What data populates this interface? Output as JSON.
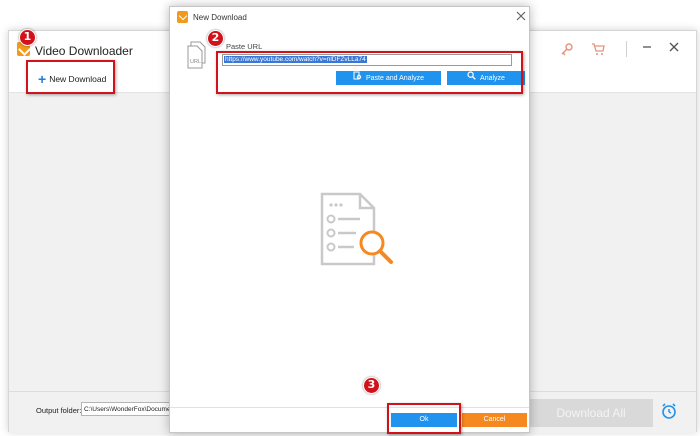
{
  "main_window": {
    "title": "Video Downloader",
    "toolbar": {
      "new_download_label": "New Download"
    },
    "bottom": {
      "output_folder_label": "Output folder:",
      "output_folder_value": "C:\\Users\\WonderFox\\Documents",
      "download_all_label": "Download All"
    },
    "icons": [
      "key-icon",
      "cart-icon",
      "minimize-icon",
      "close-icon",
      "alarm-clock-icon"
    ]
  },
  "dialog": {
    "title": "New Download",
    "paste_url_label": "Paste URL",
    "url_value": "https://www.youtube.com/watch?v=nlDFZvLLa74",
    "doc_icon_label": "URL",
    "paste_and_analyze_label": "Paste and Analyze",
    "analyze_label": "Analyze",
    "ok_label": "Ok",
    "cancel_label": "Cancel"
  },
  "annotations": {
    "step1": "1",
    "step2": "2",
    "step3": "3"
  },
  "colors": {
    "accent_blue": "#1f93ee",
    "cancel_orange": "#f5891f",
    "annotation_red": "#d1121a",
    "brand_orange": "#f29a1d"
  }
}
